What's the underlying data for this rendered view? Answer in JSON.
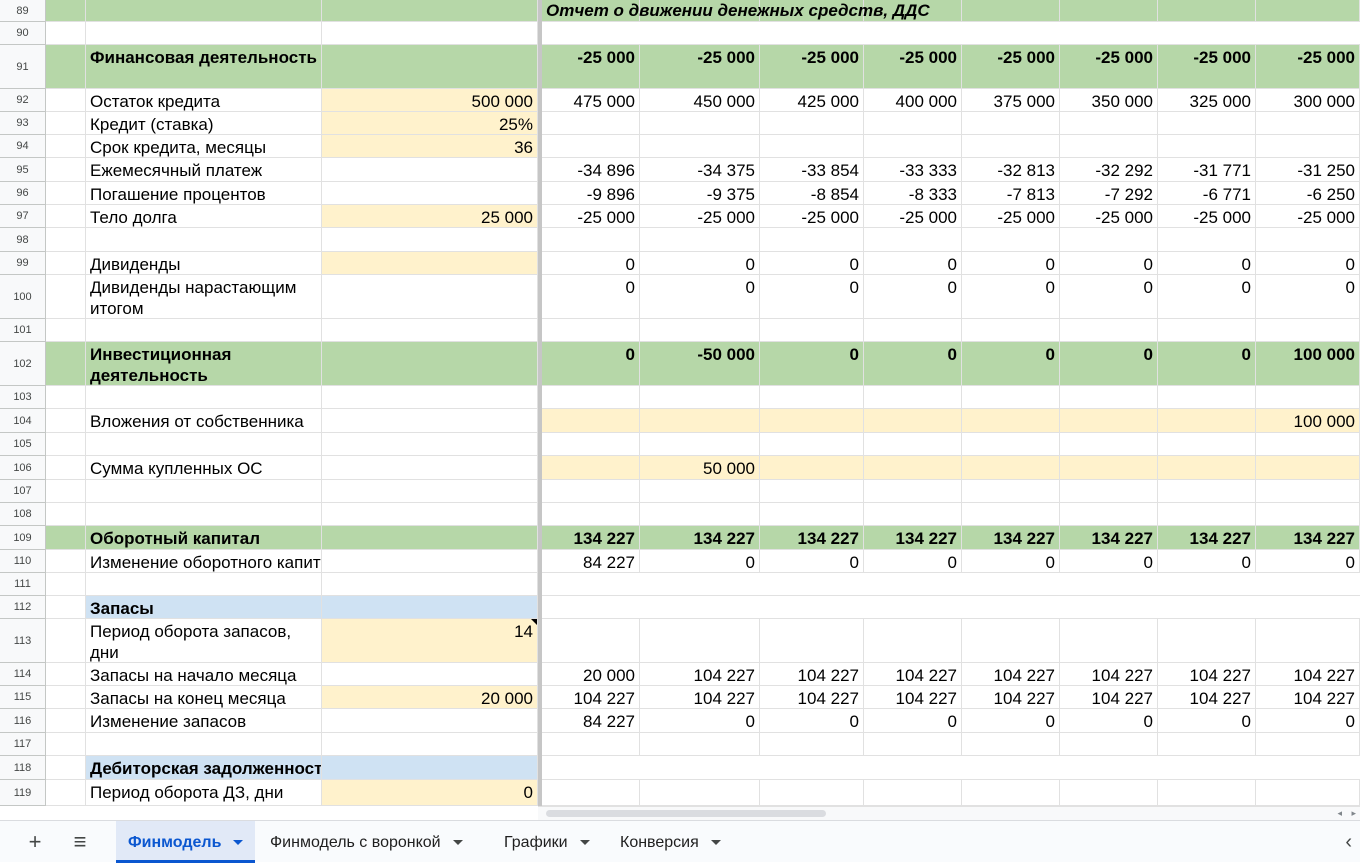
{
  "sheet": {
    "section_title": "Отчет о движении денежных средств, ДДС",
    "rows": [
      {
        "n": "89",
        "label": "",
        "c": "",
        "v": [],
        "style": "title"
      },
      {
        "n": "90",
        "label": "",
        "c": "",
        "v": [],
        "style": "plain"
      },
      {
        "n": "91",
        "label": "Финансовая деятельность",
        "c": "",
        "v": [
          "-25 000",
          "-25 000",
          "-25 000",
          "-25 000",
          "-25 000",
          "-25 000",
          "-25 000",
          "-25 000"
        ],
        "style": "green"
      },
      {
        "n": "92",
        "label": "Остаток кредита",
        "c": "500 000",
        "v": [
          "475 000",
          "450 000",
          "425 000",
          "400 000",
          "375 000",
          "350 000",
          "325 000",
          "300 000"
        ],
        "style": "inputC"
      },
      {
        "n": "93",
        "label": "Кредит (ставка)",
        "c": "25%",
        "v": [
          "",
          "",
          "",
          "",
          "",
          "",
          "",
          ""
        ],
        "style": "inputC"
      },
      {
        "n": "94",
        "label": "Срок кредита, месяцы",
        "c": "36",
        "v": [
          "",
          "",
          "",
          "",
          "",
          "",
          "",
          ""
        ],
        "style": "inputC"
      },
      {
        "n": "95",
        "label": "Ежемесячный платеж",
        "c": "",
        "v": [
          "-34 896",
          "-34 375",
          "-33 854",
          "-33 333",
          "-32 813",
          "-32 292",
          "-31 771",
          "-31 250"
        ],
        "style": "plain"
      },
      {
        "n": "96",
        "label": "Погашение процентов",
        "c": "",
        "v": [
          "-9 896",
          "-9 375",
          "-8 854",
          "-8 333",
          "-7 813",
          "-7 292",
          "-6 771",
          "-6 250"
        ],
        "style": "plain"
      },
      {
        "n": "97",
        "label": "Тело долга",
        "c": "25 000",
        "v": [
          "-25 000",
          "-25 000",
          "-25 000",
          "-25 000",
          "-25 000",
          "-25 000",
          "-25 000",
          "-25 000"
        ],
        "style": "inputC"
      },
      {
        "n": "98",
        "label": "",
        "c": "",
        "v": [
          "",
          "",
          "",
          "",
          "",
          "",
          "",
          ""
        ],
        "style": "plain"
      },
      {
        "n": "99",
        "label": "Дивиденды",
        "c": "",
        "v": [
          "0",
          "0",
          "0",
          "0",
          "0",
          "0",
          "0",
          "0"
        ],
        "style": "inputC"
      },
      {
        "n": "100",
        "label": "Дивиденды нарастающим итогом",
        "c": "",
        "v": [
          "0",
          "0",
          "0",
          "0",
          "0",
          "0",
          "0",
          "0"
        ],
        "style": "plain"
      },
      {
        "n": "101",
        "label": "",
        "c": "",
        "v": [
          "",
          "",
          "",
          "",
          "",
          "",
          "",
          ""
        ],
        "style": "plain"
      },
      {
        "n": "102",
        "label": "Инвестиционная деятельность",
        "c": "",
        "v": [
          "0",
          "-50 000",
          "0",
          "0",
          "0",
          "0",
          "0",
          "100 000"
        ],
        "style": "green"
      },
      {
        "n": "103",
        "label": "",
        "c": "",
        "v": [
          "",
          "",
          "",
          "",
          "",
          "",
          "",
          ""
        ],
        "style": "plain"
      },
      {
        "n": "104",
        "label": "Вложения от собственника",
        "c": "",
        "v": [
          "",
          "",
          "",
          "",
          "",
          "",
          "",
          "100 000"
        ],
        "style": "inputV"
      },
      {
        "n": "105",
        "label": "",
        "c": "",
        "v": [
          "",
          "",
          "",
          "",
          "",
          "",
          "",
          ""
        ],
        "style": "plain"
      },
      {
        "n": "106",
        "label": "Сумма купленных ОС",
        "c": "",
        "v": [
          "",
          "50 000",
          "",
          "",
          "",
          "",
          "",
          ""
        ],
        "style": "inputV"
      },
      {
        "n": "107",
        "label": "",
        "c": "",
        "v": [
          "",
          "",
          "",
          "",
          "",
          "",
          "",
          ""
        ],
        "style": "plain"
      },
      {
        "n": "108",
        "label": "",
        "c": "",
        "v": [
          "",
          "",
          "",
          "",
          "",
          "",
          "",
          ""
        ],
        "style": "plain"
      },
      {
        "n": "109",
        "label": "Оборотный капитал",
        "c": "",
        "v": [
          "134 227",
          "134 227",
          "134 227",
          "134 227",
          "134 227",
          "134 227",
          "134 227",
          "134 227"
        ],
        "style": "green"
      },
      {
        "n": "110",
        "label": "Изменение оборотного капитала",
        "c": "",
        "v": [
          "84 227",
          "0",
          "0",
          "0",
          "0",
          "0",
          "0",
          "0"
        ],
        "style": "plain"
      },
      {
        "n": "111",
        "label": "",
        "c": "",
        "v": [],
        "style": "plain"
      },
      {
        "n": "112",
        "label": "Запасы",
        "c": "",
        "v": [],
        "style": "blue"
      },
      {
        "n": "113",
        "label": "Период оборота запасов, дни",
        "c": "14",
        "v": [
          "",
          "",
          "",
          "",
          "",
          "",
          "",
          ""
        ],
        "style": "inputC"
      },
      {
        "n": "114",
        "label": "Запасы на начало месяца",
        "c": "",
        "v": [
          "20 000",
          "104 227",
          "104 227",
          "104 227",
          "104 227",
          "104 227",
          "104 227",
          "104 227"
        ],
        "style": "plain"
      },
      {
        "n": "115",
        "label": "Запасы на конец месяца",
        "c": "20 000",
        "v": [
          "104 227",
          "104 227",
          "104 227",
          "104 227",
          "104 227",
          "104 227",
          "104 227",
          "104 227"
        ],
        "style": "inputC"
      },
      {
        "n": "116",
        "label": "Изменение запасов",
        "c": "",
        "v": [
          "84 227",
          "0",
          "0",
          "0",
          "0",
          "0",
          "0",
          "0"
        ],
        "style": "plain"
      },
      {
        "n": "117",
        "label": "",
        "c": "",
        "v": [
          "",
          "",
          "",
          "",
          "",
          "",
          "",
          ""
        ],
        "style": "plain"
      },
      {
        "n": "118",
        "label": "Дебиторская задолженность",
        "c": "",
        "v": [
          "",
          "",
          "",
          "",
          "",
          "",
          "",
          ""
        ],
        "style": "blue"
      },
      {
        "n": "119",
        "label": "Период оборота ДЗ, дни",
        "c": "0",
        "v": [
          "",
          "",
          "",
          "",
          "",
          "",
          "",
          ""
        ],
        "style": "inputC"
      }
    ]
  },
  "tabs": {
    "add_icon": "plus-icon",
    "menu_icon": "list-icon",
    "items": [
      {
        "label": "Финмодель",
        "active": true
      },
      {
        "label": "Финмодель с воронкой",
        "active": false
      },
      {
        "label": "Графики",
        "active": false
      },
      {
        "label": "Конверсия",
        "active": false
      }
    ],
    "nav_icon": "chevron-left-icon"
  },
  "colors": {
    "section_green": "#b6d7a8",
    "section_blue": "#cfe2f3",
    "input_yellow": "#fff2cc",
    "active_tab": "#0b57d0"
  }
}
